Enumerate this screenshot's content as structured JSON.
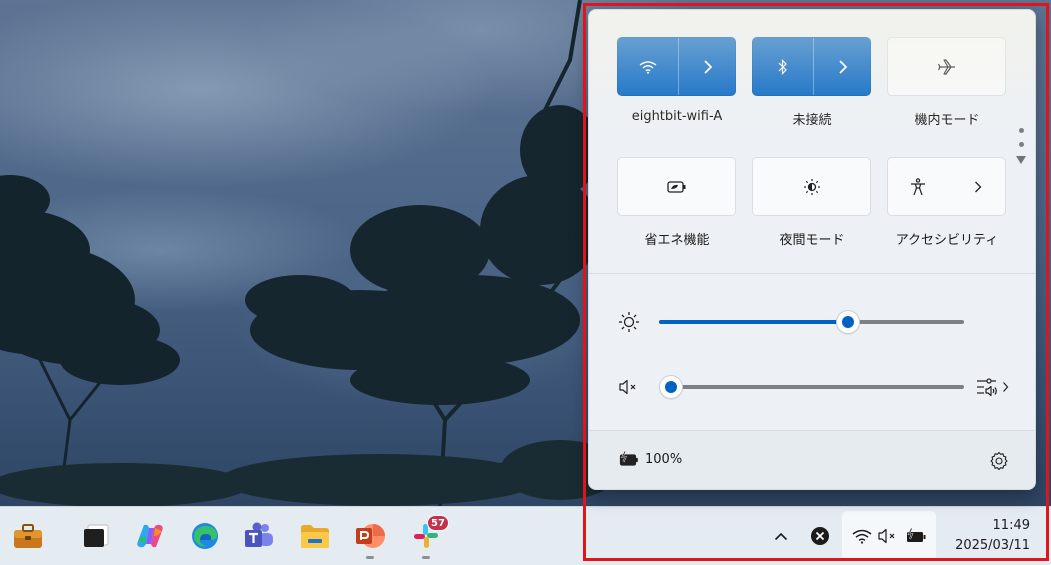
{
  "quick_settings": {
    "tiles": [
      {
        "label": "eightbit-wifi-A",
        "icon": "wifi-icon",
        "state": "on",
        "has_expand": true
      },
      {
        "label": "未接続",
        "icon": "bluetooth-icon",
        "state": "on",
        "has_expand": true
      },
      {
        "label": "機内モード",
        "icon": "airplane-icon",
        "state": "off",
        "has_expand": false
      },
      {
        "label": "省エネ機能",
        "icon": "battery-saver-icon",
        "state": "off",
        "has_expand": false
      },
      {
        "label": "夜間モード",
        "icon": "night-light-icon",
        "state": "off",
        "has_expand": false
      },
      {
        "label": "アクセシビリティ",
        "icon": "accessibility-icon",
        "state": "off",
        "has_expand": true
      }
    ],
    "brightness": {
      "icon": "brightness-icon",
      "value_fraction": 0.62
    },
    "volume": {
      "icon": "volume-muted-icon",
      "value_fraction": 0.0,
      "muted": true,
      "output_icon": "audio-output-icon"
    },
    "battery_label": "100%",
    "accent": "#0063c4"
  },
  "taskbar": {
    "apps": [
      {
        "name": "work-briefcase-icon"
      },
      {
        "name": "terminal-icon"
      },
      {
        "name": "copilot-icon"
      },
      {
        "name": "edge-icon"
      },
      {
        "name": "teams-icon"
      },
      {
        "name": "file-explorer-icon"
      },
      {
        "name": "powerpoint-icon",
        "running": true
      },
      {
        "name": "slack-icon",
        "running": true,
        "badge": "57"
      }
    ],
    "time": "11:49",
    "date": "2025/03/11"
  }
}
